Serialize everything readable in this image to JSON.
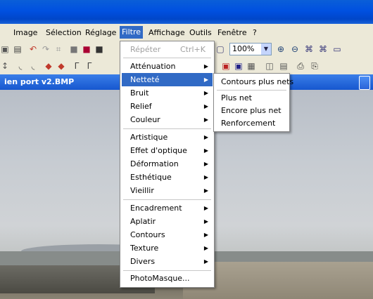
{
  "menubar": {
    "items": [
      "Image",
      "Sélection",
      "Réglage",
      "Filtre",
      "Affichage",
      "Outils",
      "Fenêtre",
      "?"
    ],
    "active": "Filtre"
  },
  "toolbar": {
    "zoom_value": "100%"
  },
  "document": {
    "title": "ien port v2.BMP"
  },
  "filtre_menu": {
    "repeat_label": "Répéter",
    "repeat_shortcut": "Ctrl+K",
    "items_group1": [
      "Atténuation",
      "Netteté",
      "Bruit",
      "Relief",
      "Couleur"
    ],
    "items_group2": [
      "Artistique",
      "Effet d'optique",
      "Déformation",
      "Esthétique",
      "Vieillir"
    ],
    "items_group3": [
      "Encadrement",
      "Aplatir",
      "Contours",
      "Texture",
      "Divers"
    ],
    "items_group4": [
      "PhotoMasque..."
    ],
    "highlighted": "Netteté"
  },
  "nettete_submenu": {
    "items": [
      "Contours plus nets",
      "Plus net",
      "Encore plus net",
      "Renforcement"
    ]
  },
  "colors": {
    "selection": "#316ac5",
    "titlebar": "#0050e0",
    "menu_bg": "#ece9d8"
  }
}
